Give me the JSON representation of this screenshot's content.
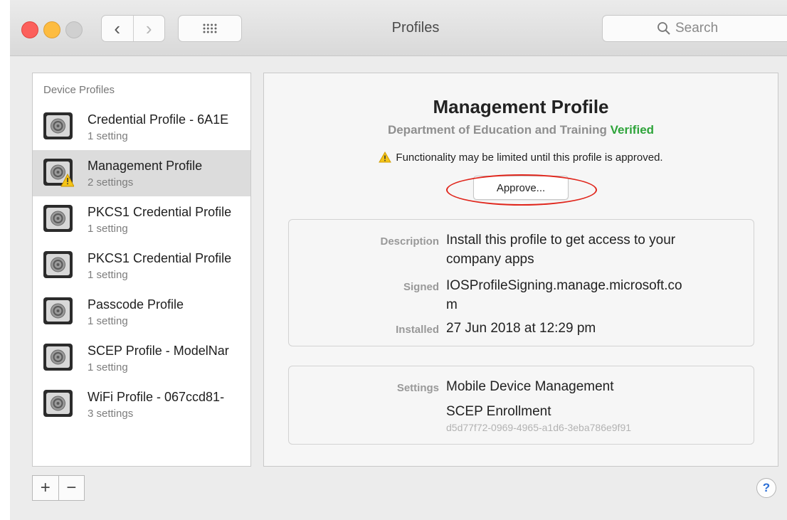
{
  "window": {
    "title": "Profiles"
  },
  "toolbar": {
    "search_placeholder": "Search",
    "back_symbol": "‹",
    "forward_symbol": "›"
  },
  "sidebar": {
    "header": "Device Profiles",
    "items": [
      {
        "name": "Credential Profile - 6A1E",
        "count": "1 setting",
        "selected": false,
        "warning": false
      },
      {
        "name": "Management Profile",
        "count": "2 settings",
        "selected": true,
        "warning": true
      },
      {
        "name": "PKCS1 Credential Profile",
        "count": "1 setting",
        "selected": false,
        "warning": false
      },
      {
        "name": "PKCS1 Credential Profile",
        "count": "1 setting",
        "selected": false,
        "warning": false
      },
      {
        "name": "Passcode Profile",
        "count": "1 setting",
        "selected": false,
        "warning": false
      },
      {
        "name": "SCEP Profile - ModelNar",
        "count": "1 setting",
        "selected": false,
        "warning": false
      },
      {
        "name": "WiFi Profile - 067ccd81-",
        "count": "3 settings",
        "selected": false,
        "warning": false
      }
    ],
    "add_label": "+",
    "remove_label": "−"
  },
  "detail": {
    "title": "Management Profile",
    "org": "Department of Education and Training",
    "verified": "Verified",
    "warning": "Functionality may be limited until this profile is approved.",
    "approve_label": "Approve...",
    "description_label": "Description",
    "description_line1": "Install this profile to get access to your",
    "description_line2": "company apps",
    "signed_label": "Signed",
    "signed_line1": "IOSProfileSigning.manage.microsoft.co",
    "signed_line2": "m",
    "installed_label": "Installed",
    "installed_value": "27 Jun 2018 at 12:29 pm",
    "settings_label": "Settings",
    "settings_item1": "Mobile Device Management",
    "settings_item2": "SCEP Enrollment",
    "settings_item2_id": "d5d77f72-0969-4965-a1d6-3eba786e9f91"
  },
  "help_label": "?",
  "colors": {
    "verified": "#2ea43a",
    "highlight_ring": "#e0261c",
    "selection": "#dcdcdc",
    "help": "#2c6fd6"
  },
  "icons": [
    "back-icon",
    "forward-icon",
    "grid-icon",
    "search-icon",
    "profile-icon",
    "warning-icon",
    "help-icon"
  ]
}
